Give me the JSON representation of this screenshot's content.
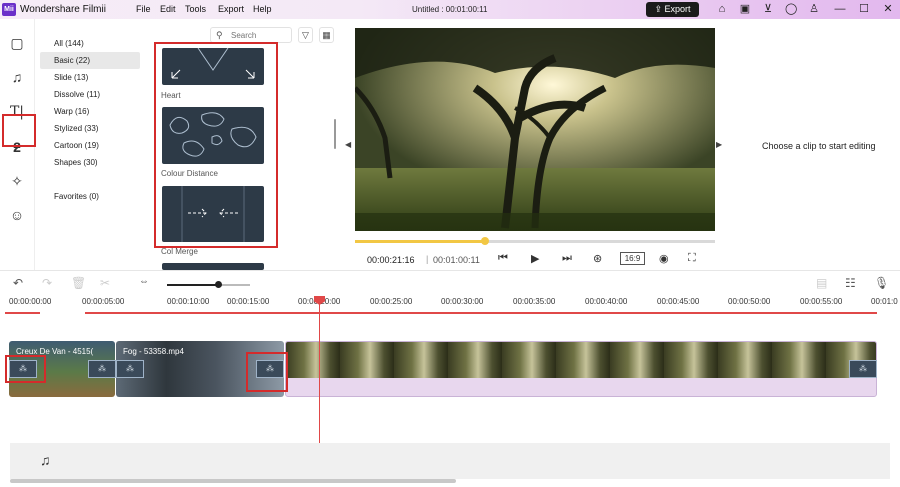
{
  "app": {
    "logo_text": "Mii",
    "title": "Wondershare Filmii",
    "menu": [
      "File",
      "Edit",
      "Tools",
      "Export",
      "Help"
    ],
    "doc_title": "Untitled :  00:01:00:11",
    "export_label": "Export",
    "toolbar_icons": [
      "home-icon",
      "save-icon",
      "cart-icon",
      "user-icon",
      "shirt-icon",
      "minimize-icon",
      "maximize-icon",
      "close-icon"
    ]
  },
  "leftbar": {
    "items": [
      "media-icon",
      "music-icon",
      "text-icon",
      "transitions-icon",
      "effects-icon",
      "stickers-icon"
    ],
    "selected": "transitions-icon"
  },
  "categories": [
    {
      "label": "All (144)"
    },
    {
      "label": "Basic (22)",
      "active": true
    },
    {
      "label": "Slide (13)"
    },
    {
      "label": "Dissolve (11)"
    },
    {
      "label": "Warp (16)"
    },
    {
      "label": "Stylized (33)"
    },
    {
      "label": "Cartoon (19)"
    },
    {
      "label": "Shapes (30)"
    },
    {
      "label": ""
    },
    {
      "label": "Favorites (0)"
    }
  ],
  "search": {
    "placeholder": "Search"
  },
  "transitions": [
    {
      "label": "Heart"
    },
    {
      "label": "Colour Distance"
    },
    {
      "label": "Col Merge"
    }
  ],
  "preview": {
    "current_time": "00:00:21:16",
    "separator": "|",
    "total_time": "00:01:00:11",
    "ratio": "16:9",
    "progress": 0.36,
    "side_message": "Choose a clip to start editing"
  },
  "timeline": {
    "zoom": 0.62,
    "ruler": [
      "00:00:00:00",
      "00:00:05:00",
      "00:00:10:00",
      "00:00:15:00",
      "00:00:20:00",
      "00:00:25:00",
      "00:00:30:00",
      "00:00:35:00",
      "00:00:40:00",
      "00:00:45:00",
      "00:00:50:00",
      "00:00:55:00",
      "00:01:0"
    ],
    "clips": [
      {
        "title": "Creux De Van - 4515("
      },
      {
        "title": "Fog - 53358.mp4"
      },
      {
        "title": ""
      }
    ]
  },
  "colors": {
    "accent": "#f2c744",
    "playhead": "#e04848",
    "highlight": "#d42b2b",
    "selected_clip": "#e8d7ee"
  }
}
